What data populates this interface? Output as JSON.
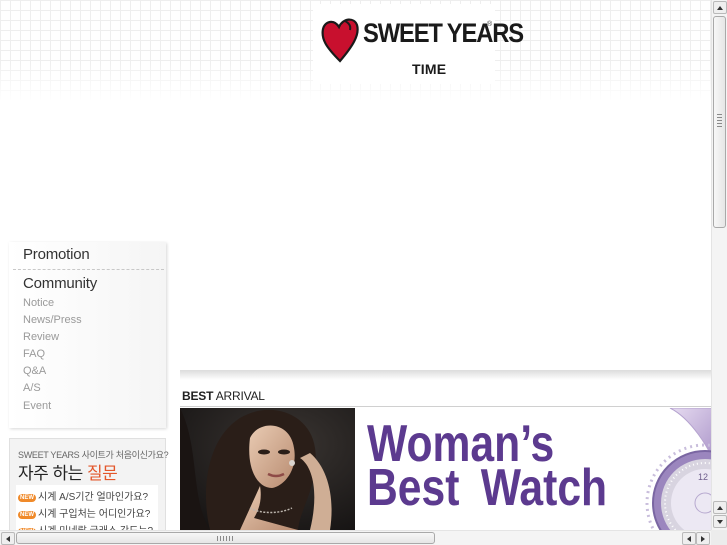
{
  "header": {
    "brand": "SWEET YEARS",
    "brand_mark": "®",
    "sub_brand": "TIME"
  },
  "sidebar": {
    "promotion": "Promotion",
    "community": "Community",
    "items": [
      {
        "label": "Notice"
      },
      {
        "label": "News/Press"
      },
      {
        "label": "Review"
      },
      {
        "label": "FAQ"
      },
      {
        "label": "Q&A"
      },
      {
        "label": "A/S"
      },
      {
        "label": "Event"
      }
    ]
  },
  "faq": {
    "intro": "SWEET YEARS 사이트가 처음이신가요?",
    "title_plain": "자주 하는",
    "title_accent": "질문",
    "badge": "NEW",
    "items": [
      {
        "text": "시계 A/S기간 얼마인가요?"
      },
      {
        "text": "시계 구입처는 어디인가요?"
      },
      {
        "text": "시계 미네랄 글래스 강도는?"
      }
    ]
  },
  "best": {
    "title_bold": "BEST",
    "title_rest": "ARRIVAL",
    "headline_line1": "Woman’s",
    "headline_word1": "Best",
    "headline_word2": "Watch"
  },
  "colors": {
    "headline": "#5c3a8f",
    "faq_accent": "#e3562a",
    "new_badge": "#f08a2a",
    "logo_heart": "#c8102e"
  },
  "icons": {
    "logo": "heart-icon",
    "scroll_up": "arrow-up-icon",
    "scroll_down": "arrow-down-icon",
    "scroll_left": "arrow-left-icon",
    "scroll_right": "arrow-right-icon"
  }
}
